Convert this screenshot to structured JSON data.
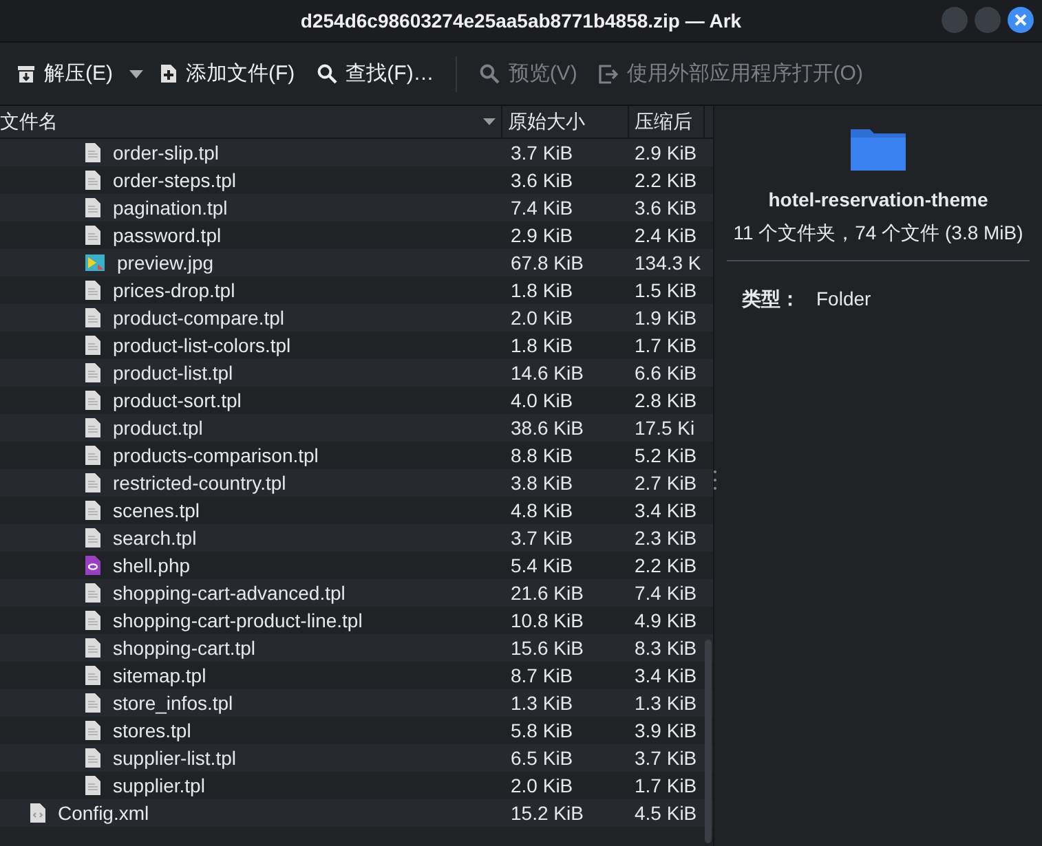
{
  "window": {
    "title": "d254d6c98603274e25aa5ab8771b4858.zip — Ark"
  },
  "toolbar": [
    {
      "label": "解压(E)",
      "kind": "extract",
      "disabled": false,
      "dropdown": true
    },
    {
      "label": "添加文件(F)",
      "kind": "add",
      "disabled": false,
      "dropdown": false
    },
    {
      "label": "查找(F)…",
      "kind": "search",
      "disabled": false,
      "dropdown": false
    },
    {
      "label": "预览(V)",
      "kind": "search",
      "disabled": true,
      "dropdown": false
    },
    {
      "label": "使用外部应用程序打开(O)",
      "kind": "open",
      "disabled": true,
      "dropdown": false
    }
  ],
  "table": {
    "columns": [
      "文件名",
      "原始大小",
      "压缩后"
    ],
    "rows": [
      {
        "children": [
          {
            "name": "order-slip.tpl",
            "kind": "text",
            "size": "3.7 KiB",
            "compressed": "2.9 KiB"
          },
          {
            "name": "order-steps.tpl",
            "kind": "text",
            "size": "3.6 KiB",
            "compressed": "2.2 KiB"
          },
          {
            "name": "pagination.tpl",
            "kind": "text",
            "size": "7.4 KiB",
            "compressed": "3.6 KiB"
          },
          {
            "name": "password.tpl",
            "kind": "text",
            "size": "2.9 KiB",
            "compressed": "2.4 KiB"
          },
          {
            "name": "preview.jpg",
            "kind": "image",
            "size": "67.8 KiB",
            "compressed": "134.3 K"
          },
          {
            "name": "prices-drop.tpl",
            "kind": "text",
            "size": "1.8 KiB",
            "compressed": "1.5 KiB"
          },
          {
            "name": "product-compare.tpl",
            "kind": "text",
            "size": "2.0 KiB",
            "compressed": "1.9 KiB"
          },
          {
            "name": "product-list-colors.tpl",
            "kind": "text",
            "size": "1.8 KiB",
            "compressed": "1.7 KiB"
          },
          {
            "name": "product-list.tpl",
            "kind": "text",
            "size": "14.6 KiB",
            "compressed": "6.6 KiB"
          },
          {
            "name": "product-sort.tpl",
            "kind": "text",
            "size": "4.0 KiB",
            "compressed": "2.8 KiB"
          },
          {
            "name": "product.tpl",
            "kind": "text",
            "size": "38.6 KiB",
            "compressed": "17.5 Ki"
          },
          {
            "name": "products-comparison.tpl",
            "kind": "text",
            "size": "8.8 KiB",
            "compressed": "5.2 KiB"
          },
          {
            "name": "restricted-country.tpl",
            "kind": "text",
            "size": "3.8 KiB",
            "compressed": "2.7 KiB"
          },
          {
            "name": "scenes.tpl",
            "kind": "text",
            "size": "4.8 KiB",
            "compressed": "3.4 KiB"
          },
          {
            "name": "search.tpl",
            "kind": "text",
            "size": "3.7 KiB",
            "compressed": "2.3 KiB"
          },
          {
            "name": "shell.php",
            "kind": "php",
            "size": "5.4 KiB",
            "compressed": "2.2 KiB"
          },
          {
            "name": "shopping-cart-advanced.tpl",
            "kind": "text",
            "size": "21.6 KiB",
            "compressed": "7.4 KiB"
          },
          {
            "name": "shopping-cart-product-line.tpl",
            "kind": "text",
            "size": "10.8 KiB",
            "compressed": "4.9 KiB"
          },
          {
            "name": "shopping-cart.tpl",
            "kind": "text",
            "size": "15.6 KiB",
            "compressed": "8.3 KiB"
          },
          {
            "name": "sitemap.tpl",
            "kind": "text",
            "size": "8.7 KiB",
            "compressed": "3.4 KiB"
          },
          {
            "name": "store_infos.tpl",
            "kind": "text",
            "size": "1.3 KiB",
            "compressed": "1.3 KiB"
          },
          {
            "name": "stores.tpl",
            "kind": "text",
            "size": "5.8 KiB",
            "compressed": "3.9 KiB"
          },
          {
            "name": "supplier-list.tpl",
            "kind": "text",
            "size": "6.5 KiB",
            "compressed": "3.7 KiB"
          },
          {
            "name": "supplier.tpl",
            "kind": "text",
            "size": "2.0 KiB",
            "compressed": "1.7 KiB"
          }
        ]
      },
      {
        "name": "Config.xml",
        "kind": "xml",
        "size": "15.2 KiB",
        "compressed": "4.5 KiB"
      }
    ]
  },
  "info": {
    "name": "hotel-reservation-theme",
    "summary": "11 个文件夹，74 个文件 (3.8 MiB)",
    "type_label": "类型：",
    "type_value": "Folder"
  }
}
